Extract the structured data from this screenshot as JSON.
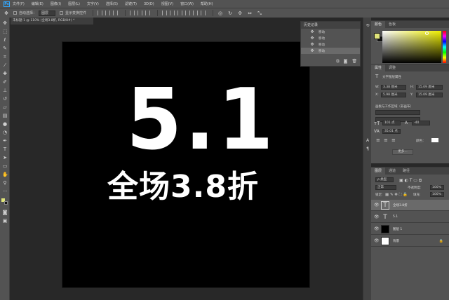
{
  "menu": {
    "logo": "Ps",
    "items": [
      "文件(F)",
      "编辑(E)",
      "图像(I)",
      "图层(L)",
      "文字(Y)",
      "选择(S)",
      "滤镜(T)",
      "3D(D)",
      "视图(V)",
      "窗口(W)",
      "帮助(H)"
    ]
  },
  "options": {
    "auto_select_label": "自动选择：",
    "auto_select_value": "图层",
    "transform_label": "显示变换控件"
  },
  "document": {
    "tab_title": "未标题-1 @ 110% (全场3.8折, RGB/8#) *",
    "headline": "5.1",
    "subline": "全场3.8折"
  },
  "history": {
    "title": "历史记录",
    "items": [
      "移动",
      "移动",
      "移动",
      "移动"
    ]
  },
  "color": {
    "tabs": [
      "颜色",
      "色板"
    ],
    "foreground": "#e0e47a",
    "background": "#111111"
  },
  "properties": {
    "tabs": [
      "属性",
      "调整"
    ],
    "heading": "文字图层属性",
    "w_label": "W:",
    "w_value": "3.38 厘米",
    "h_label": "H:",
    "h_value": "15.09 厘米",
    "x_label": "X:",
    "x_value": "5.98 厘米",
    "y_label": "Y:",
    "y_value": "15.09 厘米",
    "section": "画板与工作区域（非画布）",
    "font_size": "101 点",
    "leading": "-40",
    "tracking": "35.01 点",
    "color_label": "颜色：",
    "more_button": "更多..."
  },
  "layers": {
    "tabs": [
      "图层",
      "通道",
      "路径"
    ],
    "kind": "ρ 类型",
    "blend": "正常",
    "opacity_label": "不透明度:",
    "opacity": "100%",
    "lock_label": "锁定:",
    "fill_label": "填充:",
    "fill": "100%",
    "rows": [
      {
        "name": "全场3.8折",
        "type": "text"
      },
      {
        "name": "5.1",
        "type": "text"
      },
      {
        "name": "图层 1",
        "type": "black"
      },
      {
        "name": "背景",
        "type": "white"
      }
    ]
  }
}
